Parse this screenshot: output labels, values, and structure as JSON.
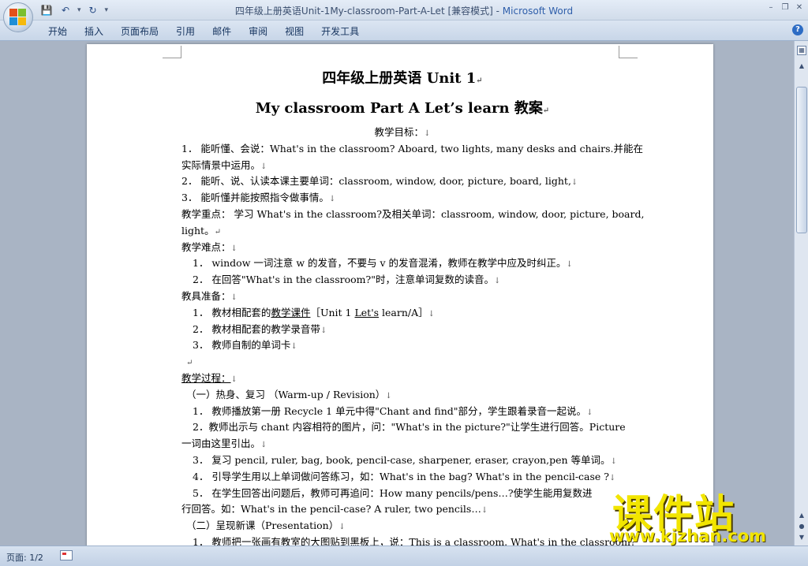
{
  "window": {
    "title": "四年级上册英语Unit-1My-classroom-Part-A-Let [兼容模式]",
    "separator": " - ",
    "app_name": "Microsoft Word"
  },
  "ribbon": {
    "tabs": [
      {
        "label": "开始"
      },
      {
        "label": "插入"
      },
      {
        "label": "页面布局"
      },
      {
        "label": "引用"
      },
      {
        "label": "邮件"
      },
      {
        "label": "审阅"
      },
      {
        "label": "视图"
      },
      {
        "label": "开发工具"
      }
    ]
  },
  "document": {
    "title": "四年级上册英语 Unit 1",
    "subtitle": "My classroom Part A Let’s  learn 教案",
    "lines": [
      "教学目标：",
      "1． 能听懂、会说：What's in the classroom? Aboard, two lights, many desks and chairs.并能在",
      "实际情景中运用。",
      "2． 能听、说、认读本课主要单词：classroom, window, door, picture, board, light,",
      "3． 能听懂并能按照指令做事情。",
      "教学重点：  学习 What's in the classroom?及相关单词：classroom, window, door, picture, board,",
      "light。",
      "教学难点：",
      "1． window 一词注意 w 的发音，不要与 v 的发音混淆，教师在教学中应及时纠正。",
      "2． 在回答\"What's in the classroom?\"时，注意单词复数的读音。",
      "教具准备：",
      "1． 教材相配套的",
      "教学课件",
      "［Unit 1 ",
      "Let's",
      " learn/A］",
      "2． 教材相配套的教学录音带",
      "3． 教师自制的单词卡",
      "教学过程：",
      "（一）热身、复习 （Warm-up / Revision）",
      "1． 教师播放第一册 Recycle 1 单元中得\"Chant and find\"部分，学生跟着录音一起说。",
      "2．教师出示与 chant 内容相符的图片，问：\"What's in the picture?\"让学生进行回答。Picture",
      "一词由这里引出。",
      "3． 复习 pencil, ruler, bag, book, pencil-case, sharpener, eraser, crayon,pen 等单词。",
      "4． 引导学生用以上单词做问答练习，如：What's in the bag? What's in the pencil-case ?",
      "5． 在学生回答出问题后，教师可再追问：How  many  pencils/pens…?使学生能用复数进",
      "行回答。如：What's in the pencil-case? A ruler, two pencils…",
      "（二）呈现新课（Presentation）",
      "1． 教师把一张画有教室的大图贴到黑板上，说：This is a classroom. What's in the classroom?"
    ],
    "marks": {
      "para": "↵",
      "arrow": "↓",
      "empty_para": "↵"
    }
  },
  "status": {
    "page": "页面: 1/2"
  },
  "watermark": {
    "main": "课件站",
    "url": "www.kjzhan.com"
  }
}
